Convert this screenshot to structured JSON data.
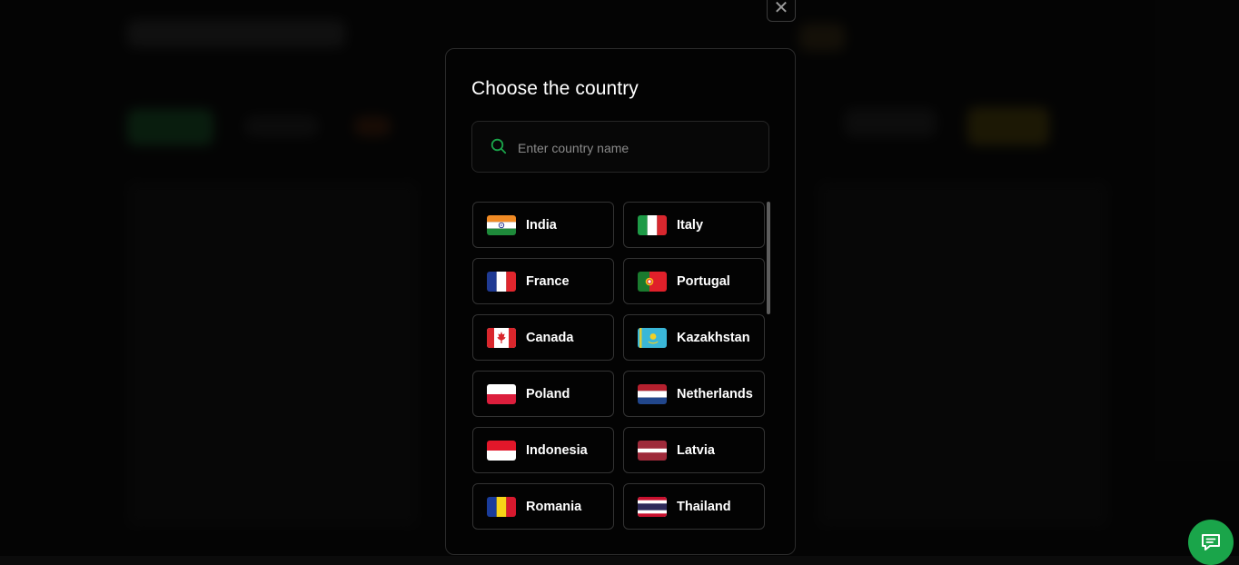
{
  "modal": {
    "title": "Choose the country",
    "search_placeholder": "Enter country name",
    "close_symbol": "✕"
  },
  "countries": [
    {
      "name": "India",
      "flag": "flag-india"
    },
    {
      "name": "Italy",
      "flag": "flag-italy"
    },
    {
      "name": "France",
      "flag": "flag-france"
    },
    {
      "name": "Portugal",
      "flag": "flag-portugal"
    },
    {
      "name": "Canada",
      "flag": "flag-canada"
    },
    {
      "name": "Kazakhstan",
      "flag": "flag-kazakhstan"
    },
    {
      "name": "Poland",
      "flag": "flag-poland"
    },
    {
      "name": "Netherlands",
      "flag": "flag-netherlands"
    },
    {
      "name": "Indonesia",
      "flag": "flag-indonesia"
    },
    {
      "name": "Latvia",
      "flag": "flag-latvia"
    },
    {
      "name": "Romania",
      "flag": "flag-romania"
    },
    {
      "name": "Thailand",
      "flag": "flag-thailand"
    }
  ],
  "icons": {
    "search": "search-icon",
    "close": "close-icon",
    "chat": "chat-icon"
  },
  "colors": {
    "accent": "#1aa54a",
    "modal_bg": "#030303",
    "border": "#333333"
  }
}
